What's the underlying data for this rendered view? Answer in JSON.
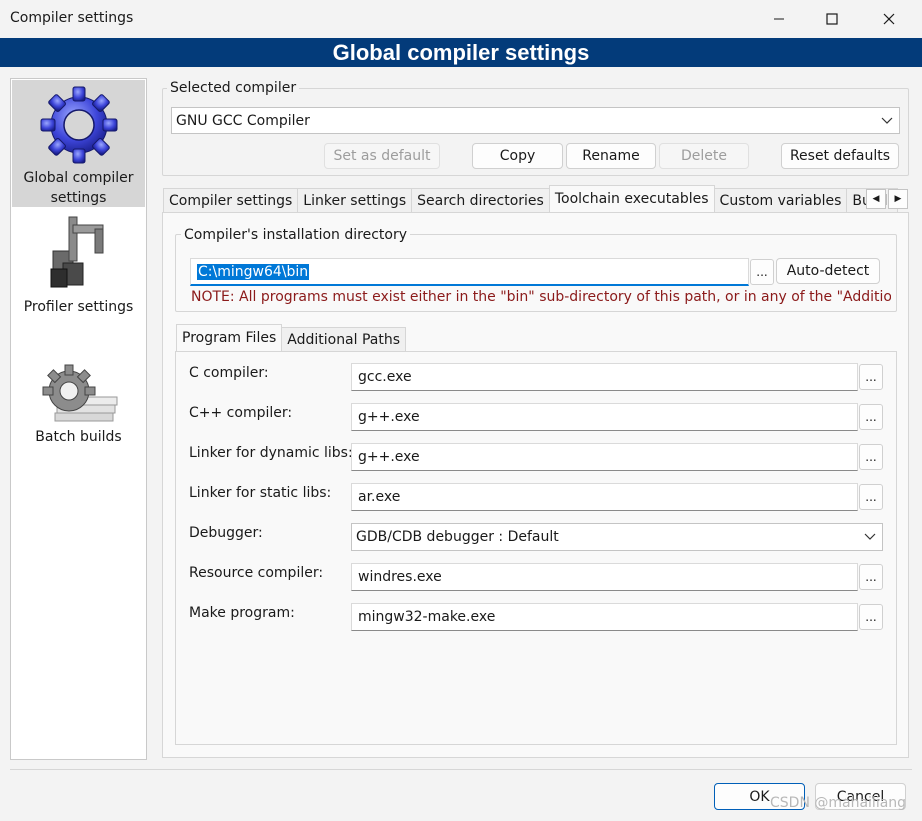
{
  "window": {
    "title": "Compiler settings"
  },
  "banner": {
    "title": "Global compiler settings"
  },
  "sidebar": {
    "items": [
      {
        "label_line1": "Global compiler",
        "label_line2": "settings"
      },
      {
        "label": "Profiler settings"
      },
      {
        "label": "Batch builds"
      }
    ]
  },
  "selected_compiler": {
    "group_label": "Selected compiler",
    "value": "GNU GCC Compiler",
    "buttons": {
      "set_default": "Set as default",
      "copy": "Copy",
      "rename": "Rename",
      "delete": "Delete",
      "reset_defaults": "Reset defaults"
    }
  },
  "tabs": [
    "Compiler settings",
    "Linker settings",
    "Search directories",
    "Toolchain executables",
    "Custom variables",
    "Build o"
  ],
  "install_dir": {
    "group_label": "Compiler's installation directory",
    "value": "C:\\mingw64\\bin",
    "browse_label": "...",
    "autodetect_label": "Auto-detect",
    "note": "NOTE: All programs must exist either in the \"bin\" sub-directory of this path, or in any of the \"Additional"
  },
  "subtabs": [
    "Program Files",
    "Additional Paths"
  ],
  "programs": [
    {
      "label": "C compiler:",
      "value": "gcc.exe"
    },
    {
      "label": "C++ compiler:",
      "value": "g++.exe"
    },
    {
      "label": "Linker for dynamic libs:",
      "value": "g++.exe"
    },
    {
      "label": "Linker for static libs:",
      "value": "ar.exe"
    },
    {
      "label": "Debugger:",
      "value": "GDB/CDB debugger : Default"
    },
    {
      "label": "Resource compiler:",
      "value": "windres.exe"
    },
    {
      "label": "Make program:",
      "value": "mingw32-make.exe"
    }
  ],
  "browse_label": "...",
  "footer": {
    "ok": "OK",
    "cancel": "Cancel"
  },
  "watermark": "CSDN @mahailiang",
  "colors": {
    "banner": "#033b7a",
    "accent": "#0078d7",
    "note": "#8b1a1a"
  }
}
